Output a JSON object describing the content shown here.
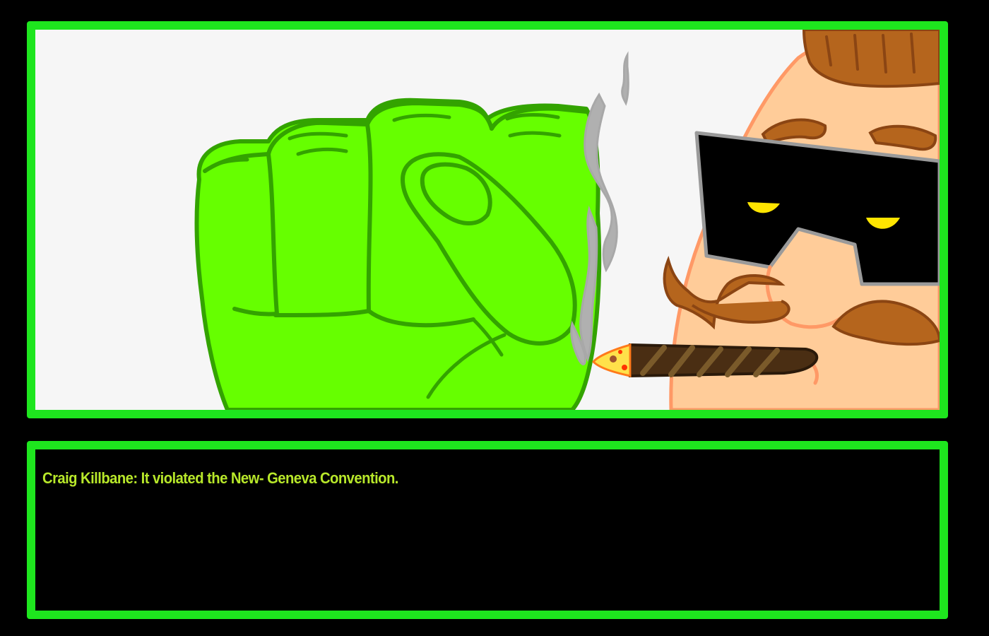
{
  "scene": {
    "background_color": "#f6f6f6",
    "frame_color": "#1ee61e",
    "elements": [
      "green-fist",
      "cigar-smoke",
      "mustached-man",
      "sunglasses",
      "cigar"
    ]
  },
  "dialog": {
    "speaker": "Craig Killbane",
    "text": "Craig Killbane: It violated the New- Geneva Convention.",
    "text_color": "#b8e82a",
    "background_color": "#000000"
  }
}
